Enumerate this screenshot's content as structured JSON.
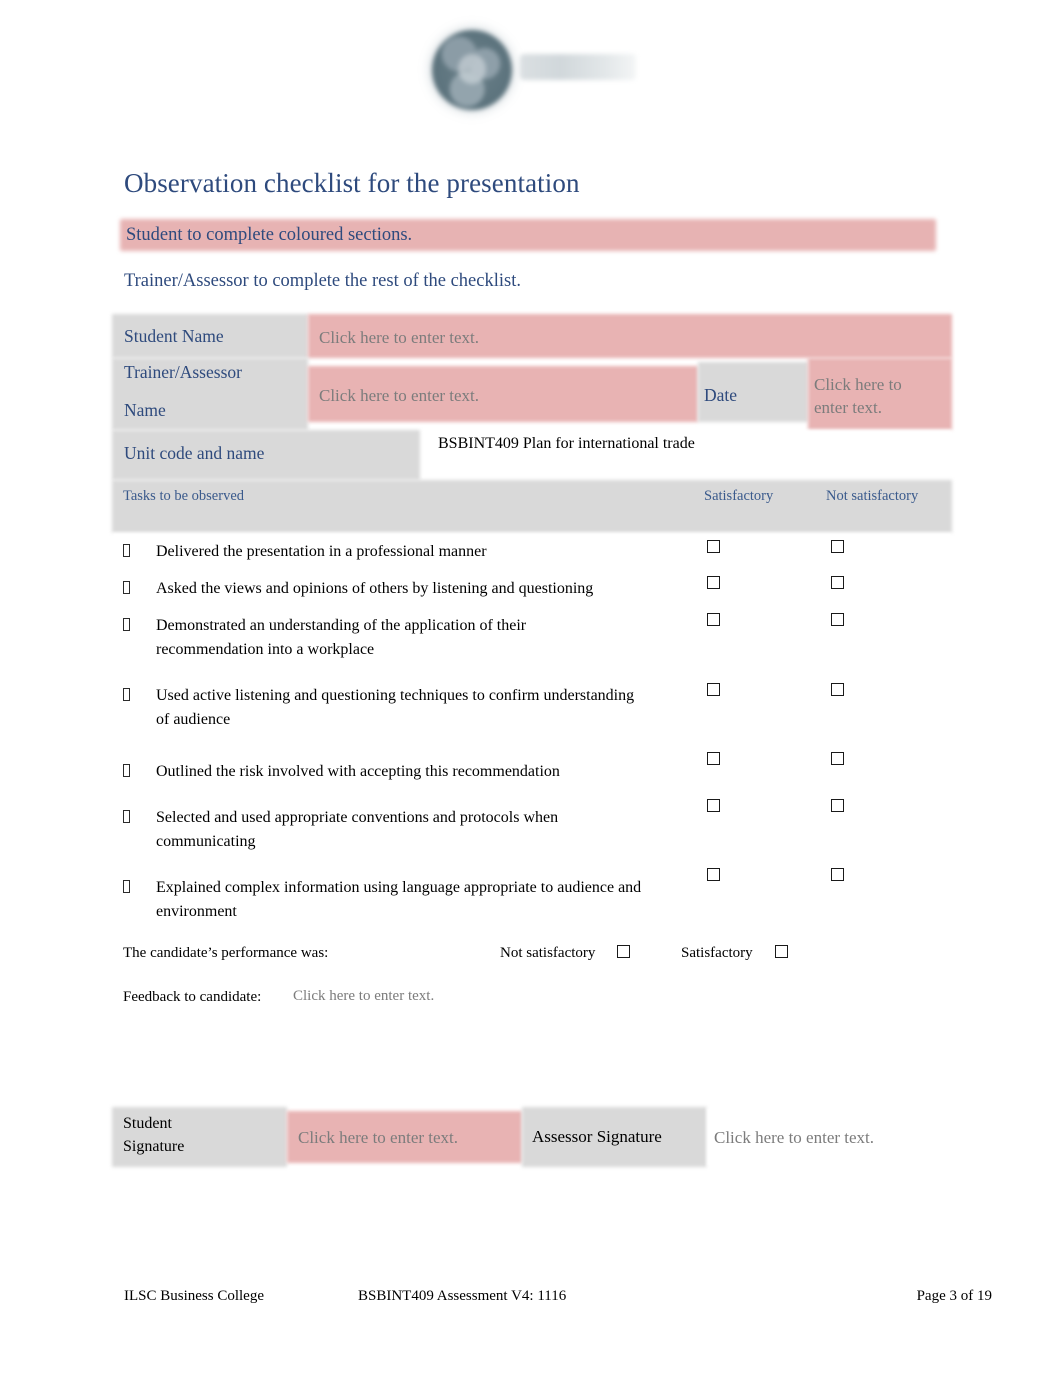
{
  "logo": {
    "name": "ilsc-logo",
    "disc_color": "#60777f",
    "wordmark_color": "#d4dadd"
  },
  "heading": {
    "title": "Observation checklist for the presentation",
    "title_color": "#2e4a7d",
    "highlight_note": "Student to complete coloured sections.",
    "highlight_color": "#e7b3b3",
    "subtitle": "Trainer/Assessor to complete the rest of the checklist."
  },
  "form": {
    "student_name_label": "Student Name",
    "student_name_value": "Click here to enter text.",
    "trainer_label_line1": "Trainer/Assessor",
    "trainer_label_line2": "Name",
    "trainer_value": "Click here to enter text.",
    "date_label": "Date",
    "date_value_line1": "Click here to",
    "date_value_line2": "enter text.",
    "unit_label": "Unit code and name",
    "unit_value": "BSBINT409 Plan for international trade",
    "label_bg": "#d9d9d9",
    "input_bg": "#e8b3b3"
  },
  "table": {
    "col_tasks": "Tasks to be observed",
    "col_satisfactory": "Satisfactory",
    "col_not_satisfactory": "Not satisfactory",
    "rows": [
      {
        "text": "Delivered the presentation in a professional manner"
      },
      {
        "text": "Asked the views and opinions of others by listening and questioning"
      },
      {
        "text": "Demonstrated an understanding of the application of their recommendation into a workplace"
      },
      {
        "text": "Used active listening and questioning techniques to confirm understanding of audience"
      },
      {
        "text": "Outlined the risk involved with accepting this recommendation"
      },
      {
        "text": "Selected and used appropriate conventions and protocols when communicating"
      },
      {
        "text": "Explained complex information using language appropriate to audience and environment"
      }
    ]
  },
  "result": {
    "prompt": "The candidate’s performance was:",
    "not_satisfactory_label": "Not satisfactory",
    "satisfactory_label": "Satisfactory"
  },
  "feedback": {
    "label": "Feedback to candidate:",
    "value": "Click here to enter text."
  },
  "signatures": {
    "student_label_line1": "Student",
    "student_label_line2": "Signature",
    "student_value": "Click here to enter text.",
    "assessor_label": "Assessor Signature",
    "assessor_value": "Click here to enter text."
  },
  "footer": {
    "college": "ILSC Business College",
    "document": "BSBINT409 Assessment V4: 1116",
    "page": "Page 3 of 19"
  }
}
